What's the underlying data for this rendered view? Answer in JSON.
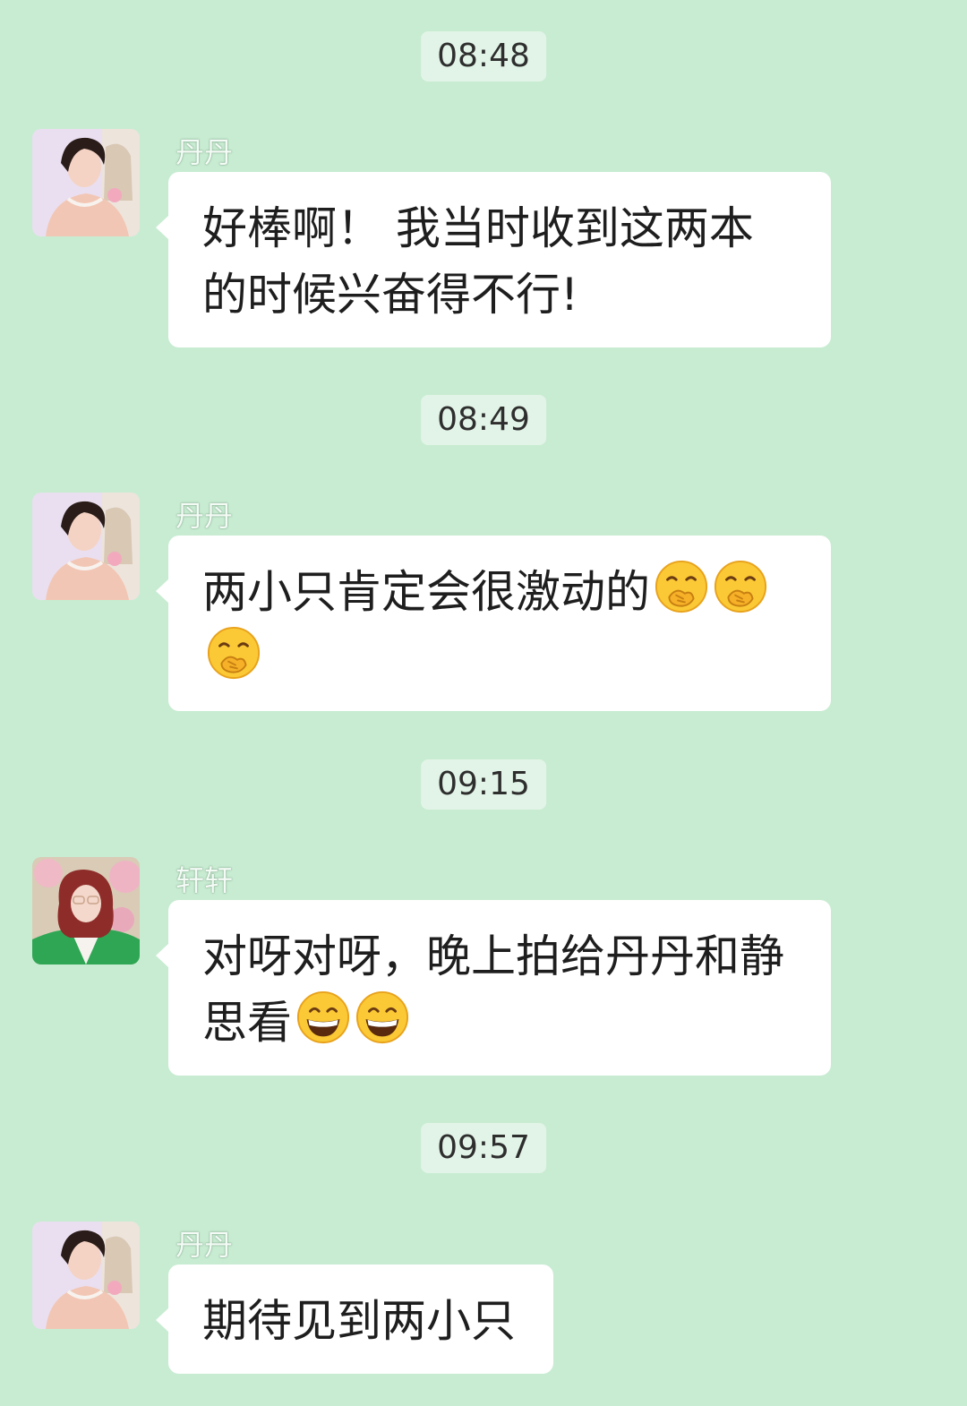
{
  "timestamps": [
    "08:48",
    "08:49",
    "09:15",
    "09:57"
  ],
  "messages": [
    {
      "sender": "丹丹",
      "avatar": "woman-pink-dress-avatar",
      "text": "好棒啊！ 我当时收到这两本的时候兴奋得不行!",
      "emojis": []
    },
    {
      "sender": "丹丹",
      "avatar": "woman-pink-dress-avatar",
      "text": "两小只肯定会很激动的",
      "emojis": [
        "face-with-hand-over-mouth-emoji",
        "face-with-hand-over-mouth-emoji",
        "face-with-hand-over-mouth-emoji"
      ]
    },
    {
      "sender": "轩轩",
      "avatar": "woman-green-jacket-avatar",
      "text": "对呀对呀，晚上拍给丹丹和静思看",
      "emojis": [
        "grinning-face-emoji",
        "grinning-face-emoji"
      ]
    },
    {
      "sender": "丹丹",
      "avatar": "woman-pink-dress-avatar",
      "text": "期待见到两小只",
      "emojis": []
    }
  ],
  "colors": {
    "background": "#c8ecd2",
    "bubble": "#ffffff",
    "timestamp_pill": "#e2f4e7"
  }
}
